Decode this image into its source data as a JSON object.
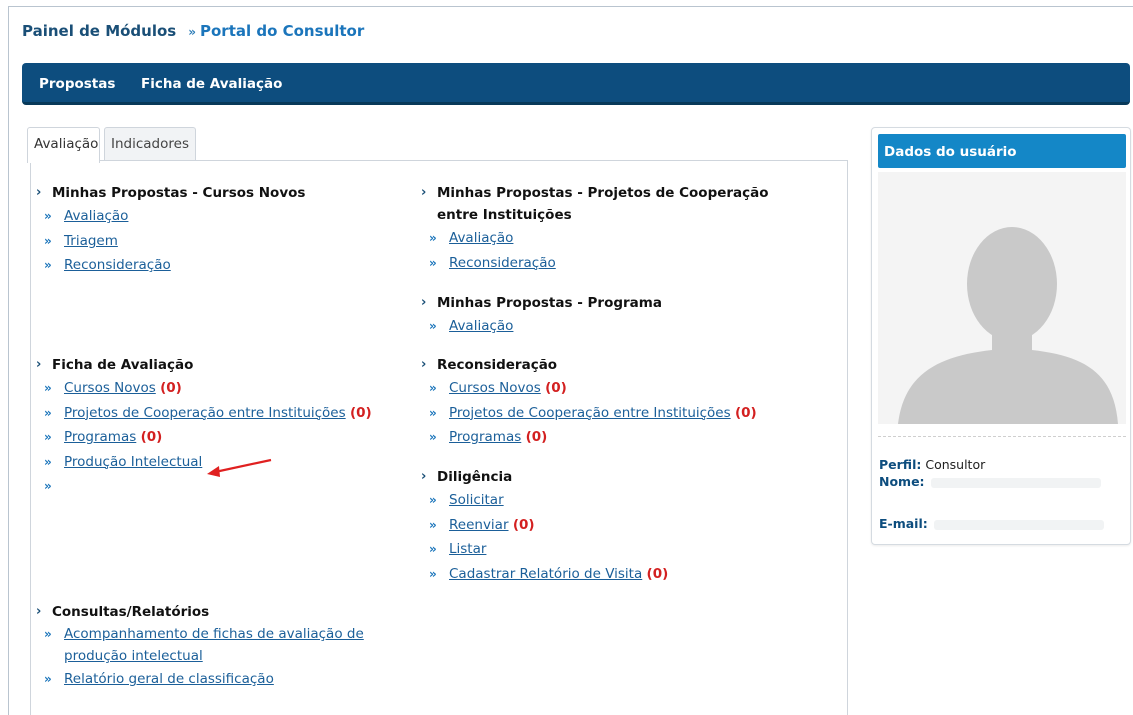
{
  "breadcrumb": {
    "root": "Painel de Módulos",
    "separator": "»",
    "current": "Portal do Consultor"
  },
  "navbar": {
    "items": [
      "Propostas",
      "Ficha de Avaliação"
    ]
  },
  "tabs": {
    "active": "Avaliação",
    "inactive": "Indicadores"
  },
  "sections": {
    "cursos_novos": {
      "title": "Minhas Propostas - Cursos Novos",
      "links": [
        "Avaliação",
        "Triagem",
        "Reconsideração"
      ]
    },
    "ficha": {
      "title": "Ficha de Avaliação",
      "links": [
        {
          "label": "Cursos Novos",
          "count": "(0)"
        },
        {
          "label": "Projetos de Cooperação entre Instituições",
          "count": "(0)"
        },
        {
          "label": "Programas",
          "count": "(0)"
        },
        {
          "label": "Produção Intelectual",
          "count": ""
        }
      ]
    },
    "consultas": {
      "title": "Consultas/Relatórios",
      "links": [
        "Acompanhamento de fichas de avaliação de produção intelectual",
        "Relatório geral de classificação"
      ]
    },
    "projetos": {
      "title": "Minhas Propostas - Projetos de Cooperação entre Instituições",
      "links": [
        "Avaliação",
        "Reconsideração"
      ]
    },
    "programa": {
      "title": "Minhas Propostas - Programa",
      "links": [
        "Avaliação"
      ]
    },
    "reconsideracao": {
      "title": "Reconsideração",
      "links": [
        {
          "label": "Cursos Novos",
          "count": "(0)"
        },
        {
          "label": "Projetos de Cooperação entre Instituições",
          "count": "(0)"
        },
        {
          "label": "Programas",
          "count": "(0)"
        }
      ]
    },
    "diligencia": {
      "title": "Diligência",
      "links": [
        {
          "label": "Solicitar",
          "count": ""
        },
        {
          "label": "Reenviar",
          "count": "(0)"
        },
        {
          "label": "Listar",
          "count": ""
        },
        {
          "label": "Cadastrar Relatório de Visita",
          "count": "(0)"
        }
      ]
    }
  },
  "user": {
    "header": "Dados do usuário",
    "perfil_label": "Perfil:",
    "perfil_value": "Consultor",
    "nome_label": "Nome:",
    "email_label": "E-mail:"
  },
  "colors": {
    "navbar": "#0d4d7e",
    "user_header": "#1487c7",
    "link": "#1b5f99",
    "count": "#d32020",
    "annotation_arrow": "#e02020"
  }
}
